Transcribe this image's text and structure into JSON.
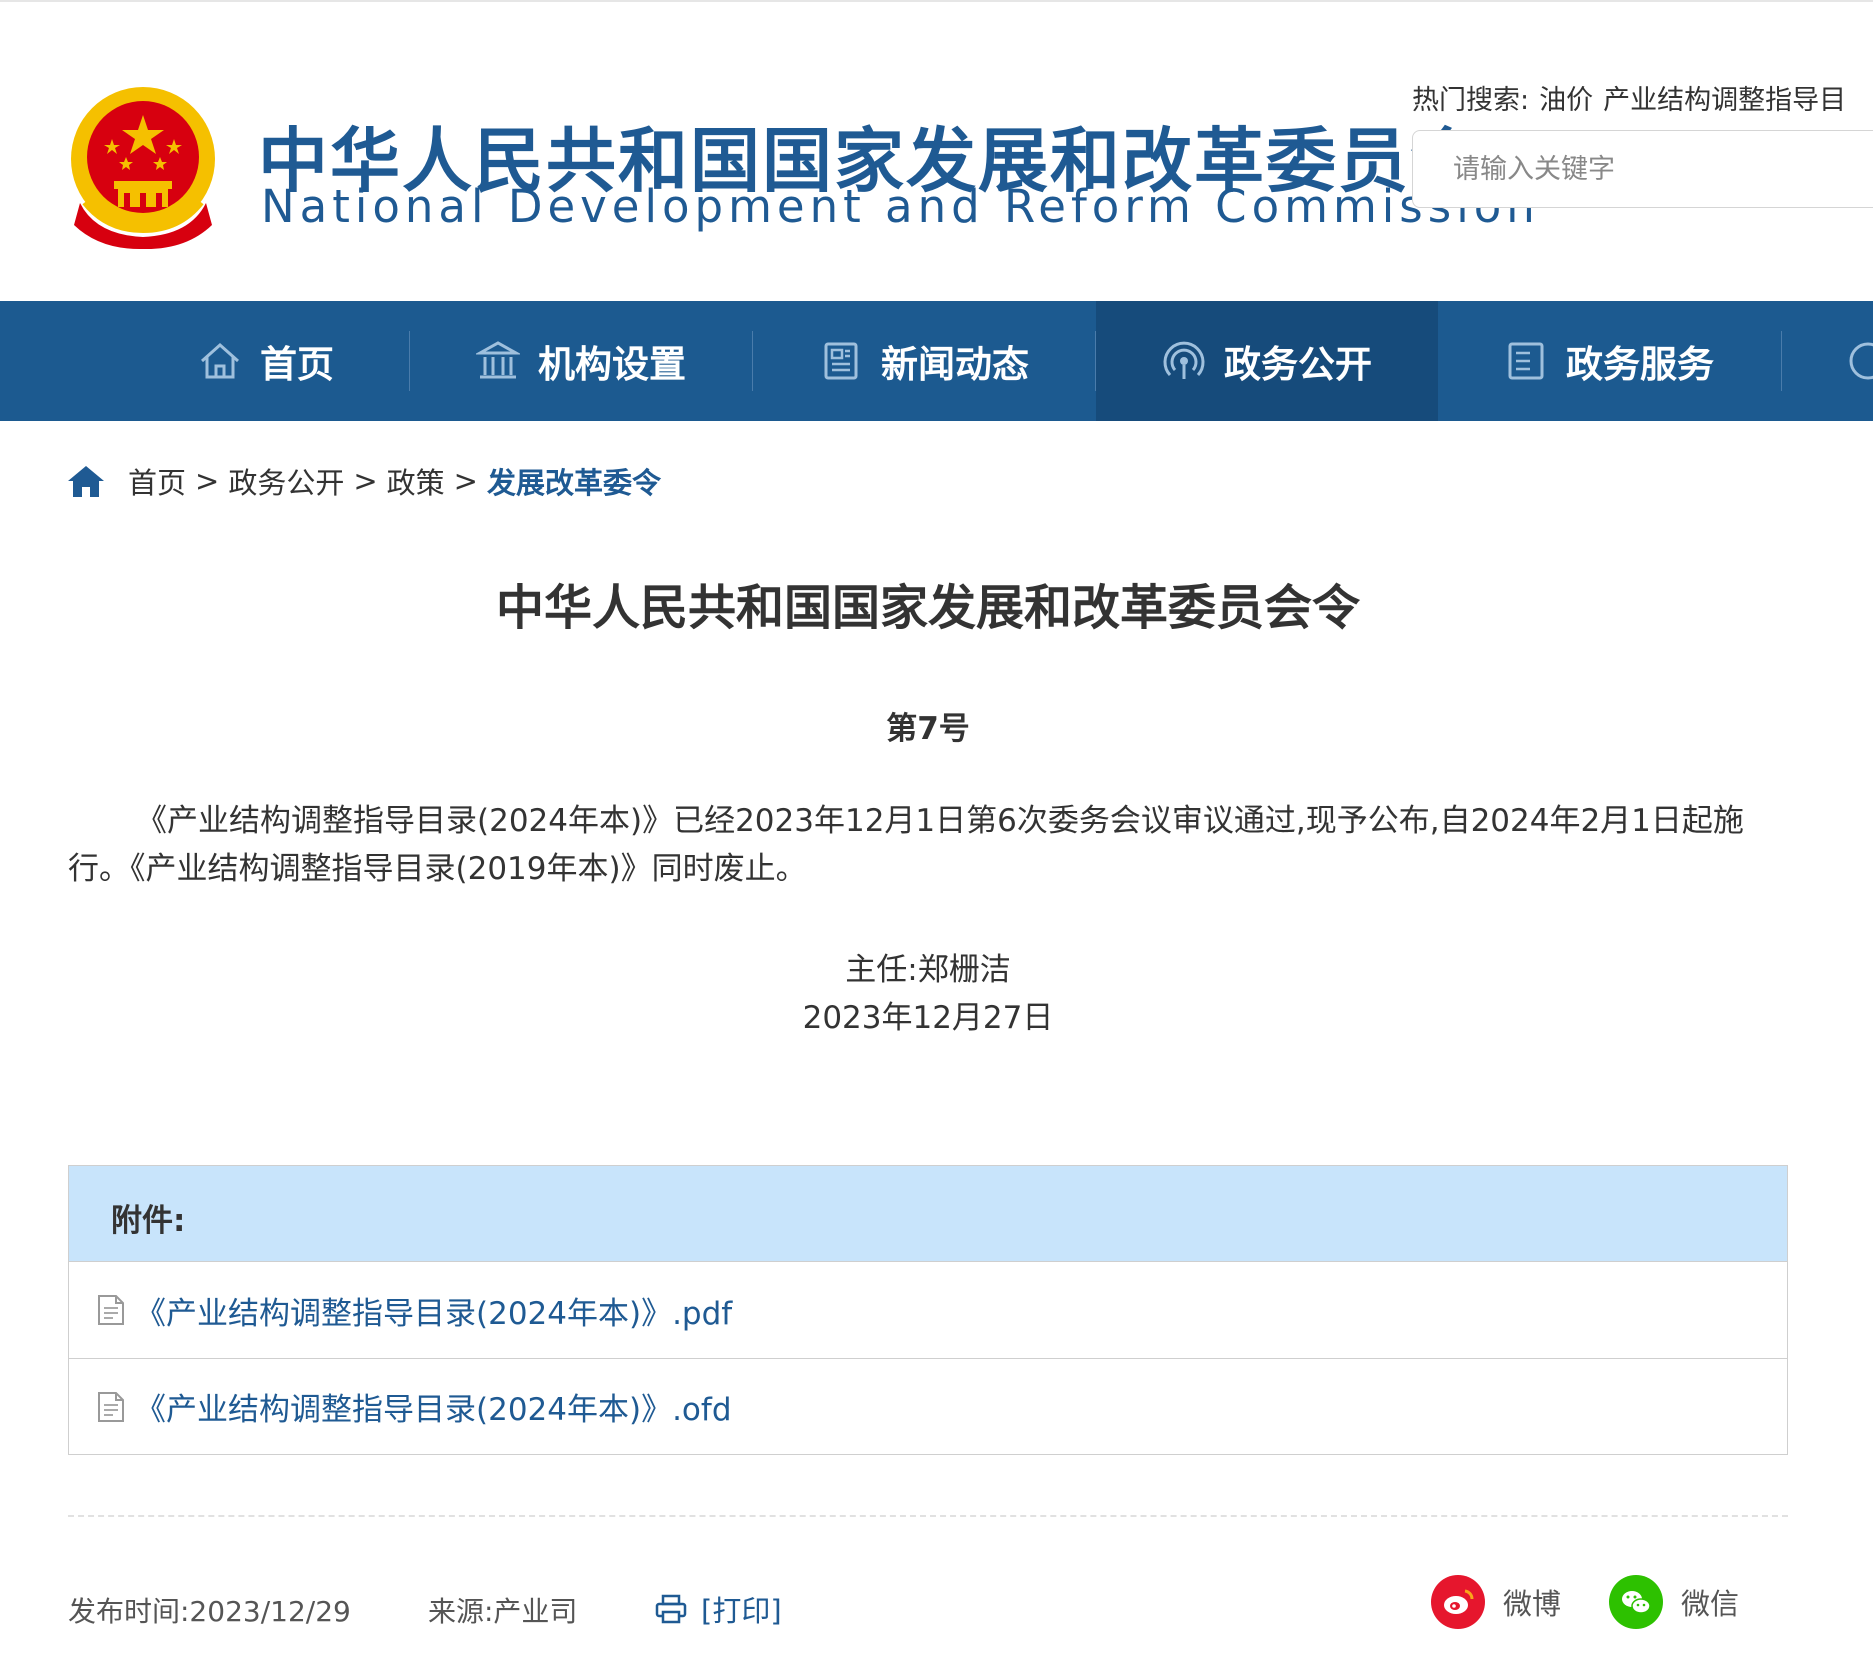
{
  "header": {
    "title_cn": "中华人民共和国国家发展和改革委员会",
    "title_en": "National Development and Reform Commission",
    "hot_search_label": "热门搜索:",
    "hot_keywords": [
      "油价",
      "产业结构调整指导目"
    ],
    "search_placeholder": "请输入关键字"
  },
  "nav": {
    "items": [
      {
        "label": "首页",
        "icon": "home-icon"
      },
      {
        "label": "机构设置",
        "icon": "institution-icon"
      },
      {
        "label": "新闻动态",
        "icon": "news-icon"
      },
      {
        "label": "政务公开",
        "icon": "broadcast-icon",
        "active": true
      },
      {
        "label": "政务服务",
        "icon": "service-icon"
      }
    ]
  },
  "breadcrumb": {
    "items": [
      "首页",
      "政务公开",
      "政策"
    ],
    "current": "发展改革委令",
    "separator": ">"
  },
  "article": {
    "title": "中华人民共和国国家发展和改革委员会令",
    "number": "第7号",
    "paragraph": "《产业结构调整指导目录(2024年本)》已经2023年12月1日第6次委务会议审议通过,现予公布,自2024年2月1日起施行。《产业结构调整指导目录(2019年本)》同时废止。",
    "signer": "主任:郑栅洁",
    "date": "2023年12月27日"
  },
  "attachments": {
    "heading": "附件:",
    "files": [
      "《产业结构调整指导目录(2024年本)》.pdf",
      "《产业结构调整指导目录(2024年本)》.ofd"
    ]
  },
  "footer": {
    "publish_time": "发布时间:2023/12/29",
    "source": "来源:产业司",
    "print_label": "[打印]",
    "share_weibo": "微博",
    "share_wechat": "微信"
  },
  "colors": {
    "brand_blue": "#1c5a90",
    "nav_active": "#164b7b",
    "attachment_header": "#c8e4fb",
    "emblem_red": "#d7000f",
    "emblem_gold": "#f5c000",
    "weibo_red": "#e6162d",
    "wechat_green": "#2dc100"
  }
}
